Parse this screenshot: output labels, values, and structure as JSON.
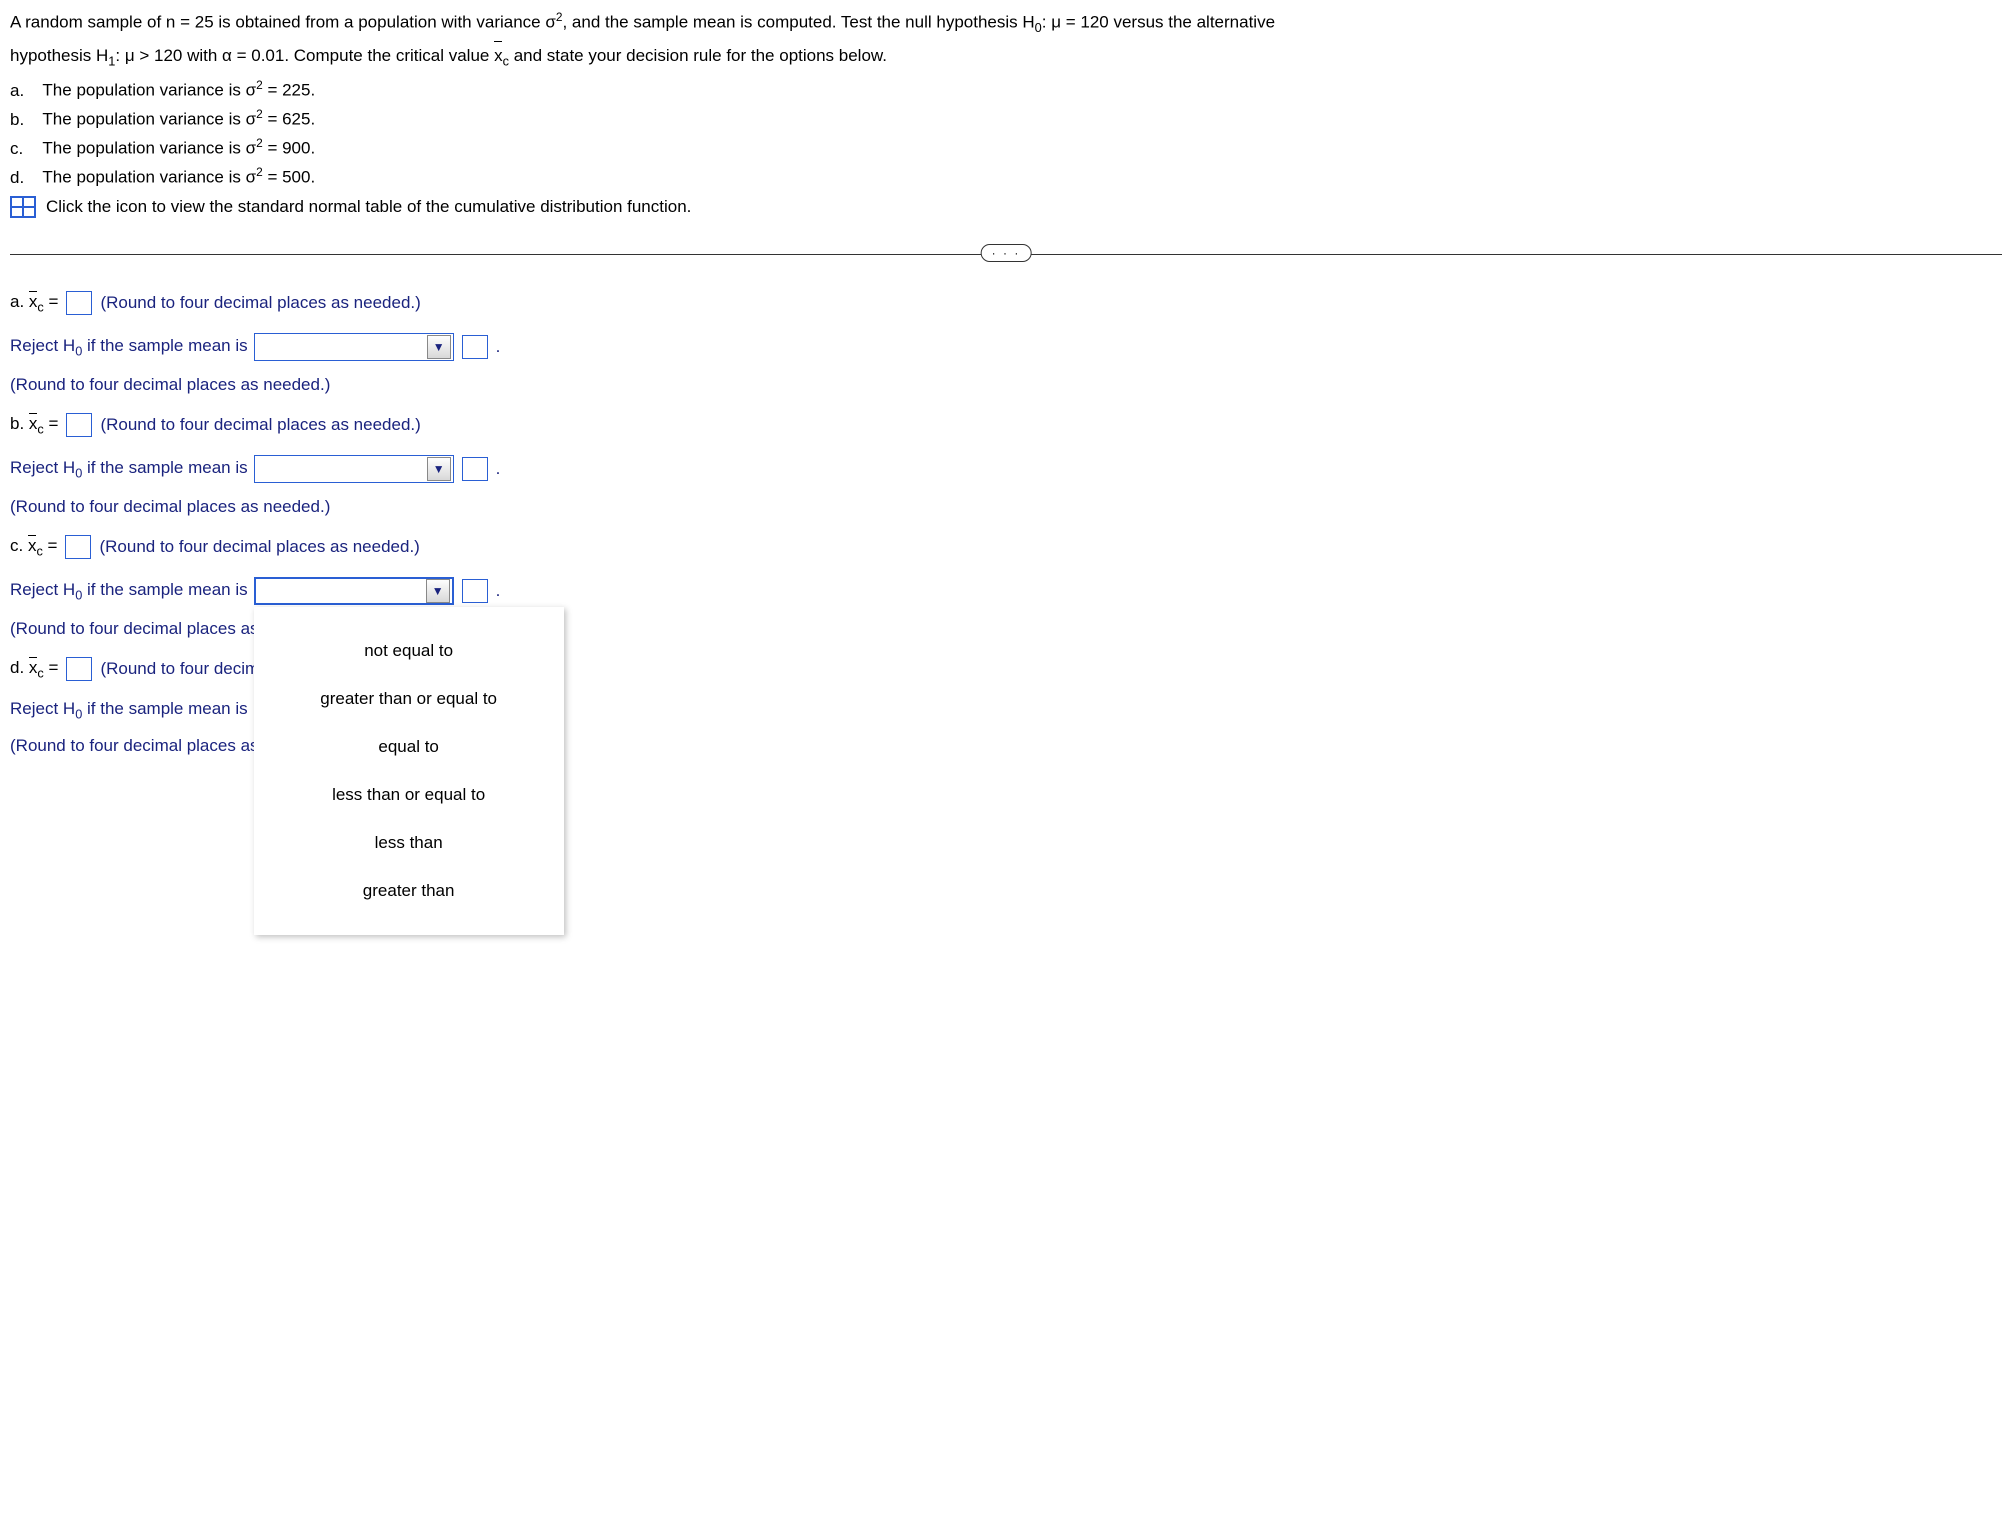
{
  "intro1_pre": "A random sample of n = 25 is obtained from a population with variance σ",
  "intro1_post": ", and the sample mean is computed. Test the null hypothesis H",
  "intro1_tail": ": μ = 120 versus the alternative",
  "intro2_pre": "hypothesis H",
  "intro2_mid": ": μ > 120 with α = 0.01. Compute the critical value ",
  "xc_text": "x",
  "intro2_post": " and state your decision rule for the options below.",
  "options": {
    "a": {
      "label": "a.",
      "text_pre": "The population variance is σ",
      "text_post": " = 225."
    },
    "b": {
      "label": "b.",
      "text_pre": "The population variance is σ",
      "text_post": " = 625."
    },
    "c": {
      "label": "c.",
      "text_pre": "The population variance is σ",
      "text_post": " = 900."
    },
    "d": {
      "label": "d.",
      "text_pre": "The population variance is σ",
      "text_post": " = 500."
    }
  },
  "table_hint": "Click the icon to view the standard normal table of the cumulative distribution function.",
  "divider_badge": "· · ·",
  "parts": {
    "a": {
      "label": "a. ",
      "round_hint": "(Round to four decimal places as needed.)"
    },
    "b": {
      "label": "b. ",
      "round_hint": "(Round to four decimal places as needed.)"
    },
    "c": {
      "label": "c. ",
      "round_hint": "(Round to four decimal places as needed.)"
    },
    "d": {
      "label": "d. ",
      "round_hint_trunc": "(Round to four decima"
    }
  },
  "xc_eq": " = ",
  "sub_c": "c",
  "sub_0": "0",
  "sub_1": "1",
  "sup_2": "2",
  "reject_pre": "Reject H",
  "reject_post": " if the sample mean is",
  "round_hint_full": "(Round to four decimal places as needed.)",
  "round_hint_trunc": "(Round to four decimal places as",
  "period": ".",
  "dropdown_options": [
    "not equal to",
    "greater than or equal to",
    "equal to",
    "less than or equal to",
    "less than",
    "greater than"
  ]
}
